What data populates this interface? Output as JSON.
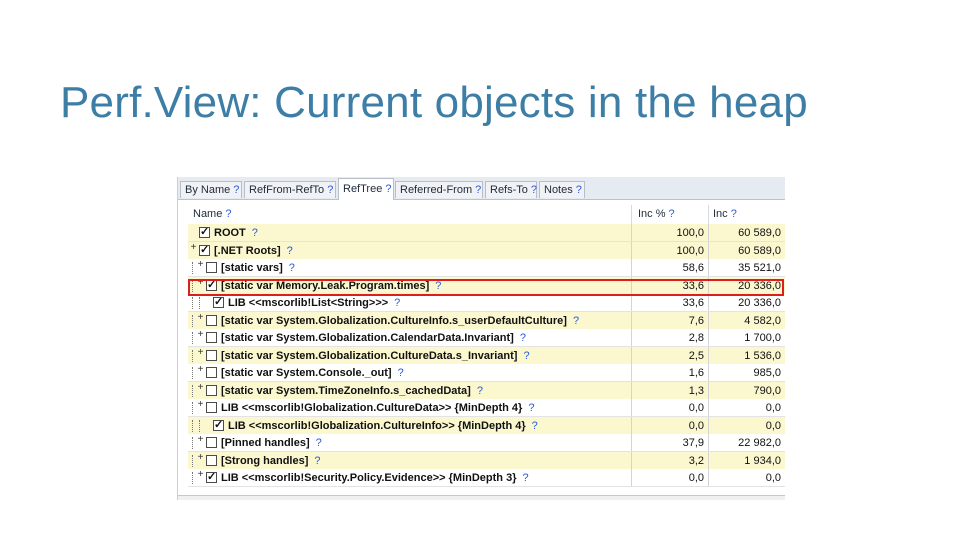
{
  "slide": {
    "title": "Perf.View: Current objects in the heap"
  },
  "tabs": [
    {
      "label": "By Name",
      "help": "?"
    },
    {
      "label": "RefFrom-RefTo",
      "help": "?"
    },
    {
      "label": "RefTree",
      "help": "?"
    },
    {
      "label": "Referred-From",
      "help": "?"
    },
    {
      "label": "Refs-To",
      "help": "?"
    },
    {
      "label": "Notes",
      "help": "?"
    }
  ],
  "active_tab": "RefTree",
  "columns": [
    {
      "label": "Name",
      "help": "?"
    },
    {
      "label": "Inc %",
      "help": "?"
    },
    {
      "label": "Inc",
      "help": "?"
    }
  ],
  "rows": [
    {
      "name": "ROOT",
      "help": "?",
      "inc_pct": "100,0",
      "inc": "60 589,0",
      "checked": true,
      "expander": "",
      "highlighted": true
    },
    {
      "name": "[.NET Roots]",
      "help": "?",
      "inc_pct": "100,0",
      "inc": "60 589,0",
      "checked": true,
      "expander": "+",
      "highlighted": true
    },
    {
      "name": "[static vars]",
      "help": "?",
      "inc_pct": "58,6",
      "inc": "35 521,0",
      "checked": false,
      "expander": "+",
      "highlighted": false
    },
    {
      "name": "[static var Memory.Leak.Program.times]",
      "help": "?",
      "inc_pct": "33,6",
      "inc": "20 336,0",
      "checked": true,
      "expander": "+",
      "highlighted": true
    },
    {
      "name": "LIB <<mscorlib!List<String>>>",
      "help": "?",
      "inc_pct": "33,6",
      "inc": "20 336,0",
      "checked": true,
      "expander": "",
      "highlighted": false
    },
    {
      "name": "[static var System.Globalization.CultureInfo.s_userDefaultCulture]",
      "help": "?",
      "inc_pct": "7,6",
      "inc": "4 582,0",
      "checked": false,
      "expander": "+",
      "highlighted": true
    },
    {
      "name": "[static var System.Globalization.CalendarData.Invariant]",
      "help": "?",
      "inc_pct": "2,8",
      "inc": "1 700,0",
      "checked": false,
      "expander": "+",
      "highlighted": false
    },
    {
      "name": "[static var System.Globalization.CultureData.s_Invariant]",
      "help": "?",
      "inc_pct": "2,5",
      "inc": "1 536,0",
      "checked": false,
      "expander": "+",
      "highlighted": true
    },
    {
      "name": "[static var System.Console._out]",
      "help": "?",
      "inc_pct": "1,6",
      "inc": "985,0",
      "checked": false,
      "expander": "+",
      "highlighted": false
    },
    {
      "name": "[static var System.TimeZoneInfo.s_cachedData]",
      "help": "?",
      "inc_pct": "1,3",
      "inc": "790,0",
      "checked": false,
      "expander": "+",
      "highlighted": true
    },
    {
      "name": "LIB <<mscorlib!Globalization.CultureData>> {MinDepth 4}",
      "help": "?",
      "inc_pct": "0,0",
      "inc": "0,0",
      "checked": false,
      "expander": "+",
      "highlighted": false
    },
    {
      "name": "LIB <<mscorlib!Globalization.CultureInfo>> {MinDepth 4}",
      "help": "?",
      "inc_pct": "0,0",
      "inc": "0,0",
      "checked": true,
      "expander": "",
      "highlighted": true
    },
    {
      "name": "[Pinned handles]",
      "help": "?",
      "inc_pct": "37,9",
      "inc": "22 982,0",
      "checked": false,
      "expander": "+",
      "highlighted": false
    },
    {
      "name": "[Strong handles]",
      "help": "?",
      "inc_pct": "3,2",
      "inc": "1 934,0",
      "checked": false,
      "expander": "+",
      "highlighted": true
    },
    {
      "name": "LIB <<mscorlib!Security.Policy.Evidence>> {MinDepth 3}",
      "help": "?",
      "inc_pct": "0,0",
      "inc": "0,0",
      "checked": true,
      "expander": "+",
      "highlighted": false
    }
  ]
}
